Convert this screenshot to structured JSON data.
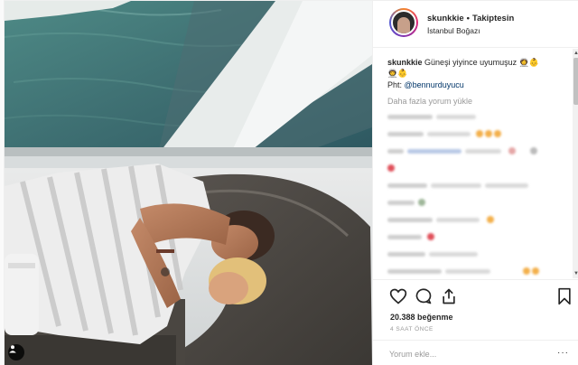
{
  "header": {
    "username": "skunkkie",
    "separator": "•",
    "follow_label": "Takiptesin",
    "location": "İstanbul Boğazı"
  },
  "caption": {
    "username": "skunkkie",
    "text": "Güneşi yiyince uyumuşuz 👩‍🚀👶",
    "line2": "👨‍🚀👶",
    "credit_prefix": "Pht:",
    "credit_handle": "@bennurduyucu"
  },
  "load_more_label": "Daha fazla yorum yükle",
  "likes": "20.388 beğenme",
  "time_ago": "4 SAAT ÖNCE",
  "comment_placeholder": "Yorum ekle...",
  "more_options": "···",
  "icons": {
    "like": "heart-icon",
    "comment": "comment-icon",
    "share": "share-icon",
    "save": "bookmark-icon",
    "tag": "person-tag-icon"
  },
  "colors": {
    "link": "#003569",
    "secondary_text": "#999999",
    "primary_text": "#262626"
  }
}
